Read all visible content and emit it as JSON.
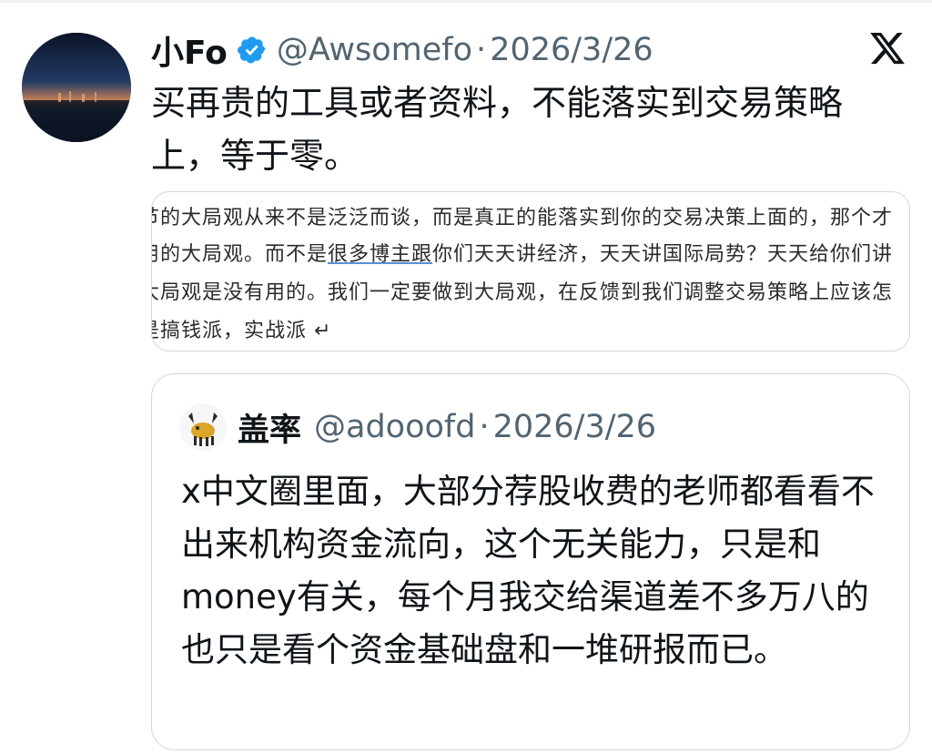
{
  "author": {
    "name": "小Fo",
    "handle": "@Awsomefo",
    "separator": "·",
    "date": "2026/3/26"
  },
  "post": {
    "text": "买再贵的工具或者资料，不能落实到交易策略上，等于零。"
  },
  "media_image": {
    "lines": [
      "节的大局观从来不是泛泛而谈，而是真正的能落实到你的交易决策上面的，那个才",
      "用的大局观。而不是很多博主跟你们天天讲经济，天天讲国际局势？天天给你们讲",
      "大局观是没有用的。我们一定要做到大局观，在反馈到我们调整交易策略上应该怎",
      "是搞钱派，实战派 ↵"
    ],
    "underlined": "很多博主跟"
  },
  "quoted": {
    "name": "盖率",
    "handle": "@adooofd",
    "separator": "·",
    "date": "2026/3/26",
    "text": "x中文圈里面，大部分荐股收费的老师都看看不出来机构资金流向，这个无关能力，只是和money有关，每个月我交给渠道差不多万八的也只是看个资金基础盘和一堆研报而已。"
  },
  "icons": {
    "verified": "verified-badge-icon",
    "platform": "x-logo-icon"
  },
  "colors": {
    "verified": "#1d9bf0",
    "secondary_text": "#536471",
    "border": "#cfd9de"
  }
}
